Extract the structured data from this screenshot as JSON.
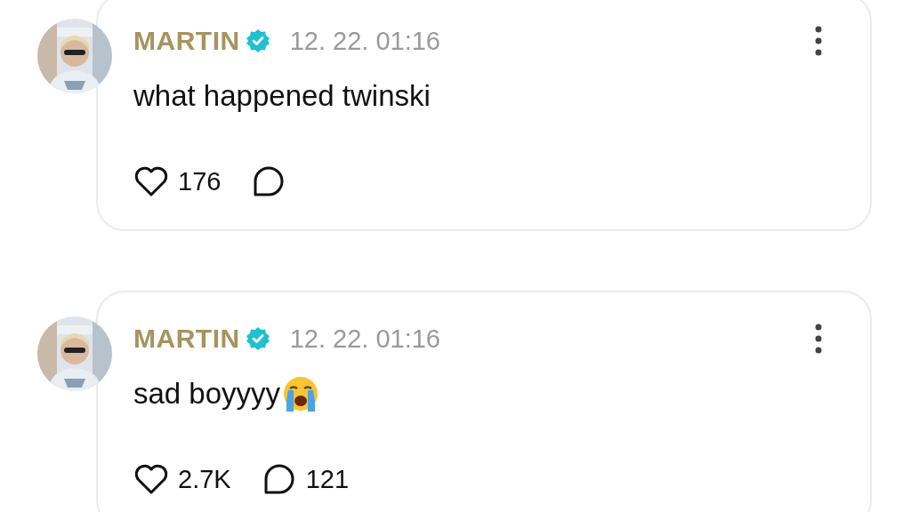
{
  "posts": [
    {
      "author": "MARTIN",
      "verified": true,
      "time": "12. 22. 01:16",
      "text": "what happened twinski",
      "emoji": false,
      "likes": "176"
    },
    {
      "author": "MARTIN",
      "verified": true,
      "time": "12. 22. 01:16",
      "text": "sad boyyyy",
      "emoji": true,
      "likes": "2.7K",
      "replies": "121"
    }
  ]
}
